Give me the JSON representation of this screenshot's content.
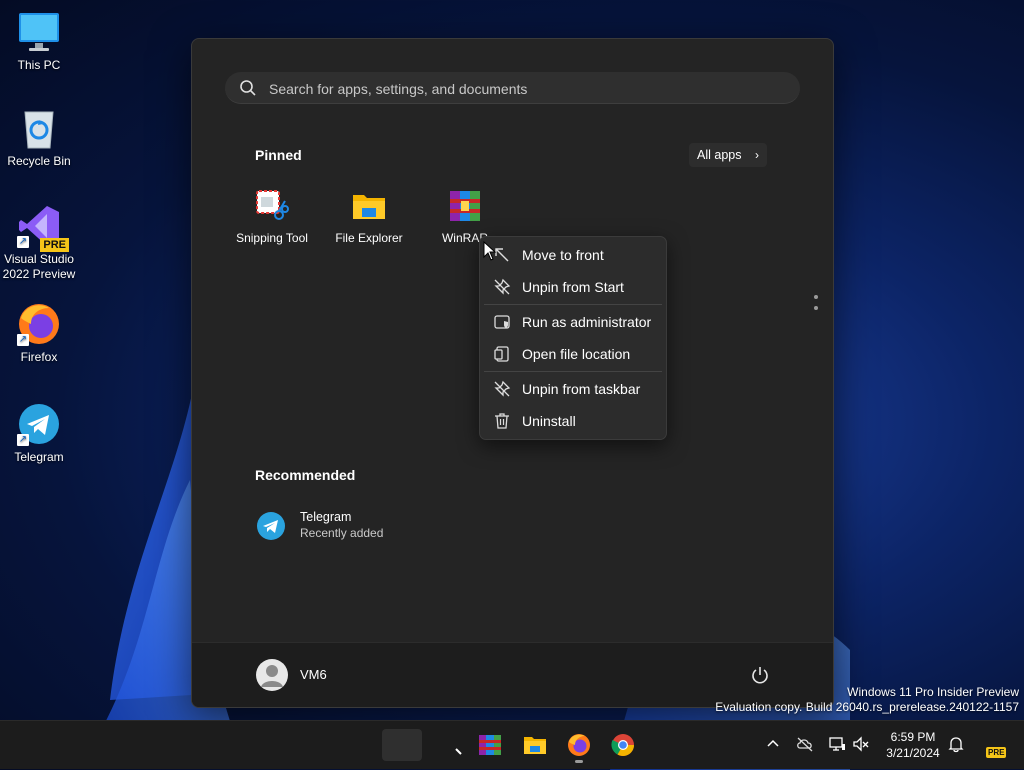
{
  "desktop": {
    "icons": [
      {
        "label": "This PC"
      },
      {
        "label": "Recycle Bin"
      },
      {
        "label": "Visual Studio 2022 Preview",
        "badge": "PRE"
      },
      {
        "label": "Firefox"
      },
      {
        "label": "Telegram"
      }
    ]
  },
  "start_menu": {
    "search_placeholder": "Search for apps, settings, and documents",
    "pinned_title": "Pinned",
    "all_apps_label": "All apps",
    "pinned": [
      {
        "label": "Snipping Tool"
      },
      {
        "label": "File Explorer"
      },
      {
        "label": "WinRAR"
      }
    ],
    "recommended_title": "Recommended",
    "recommended": [
      {
        "name": "Telegram",
        "subtitle": "Recently added"
      }
    ],
    "user_name": "VM6"
  },
  "context_menu": {
    "items": [
      {
        "label": "Move to front",
        "icon": "move-front-icon"
      },
      {
        "label": "Unpin from Start",
        "icon": "unpin-icon"
      },
      {
        "label": "Run as administrator",
        "icon": "shield-icon"
      },
      {
        "label": "Open file location",
        "icon": "folder-location-icon"
      },
      {
        "label": "Unpin from taskbar",
        "icon": "unpin-icon"
      },
      {
        "label": "Uninstall",
        "icon": "trash-icon"
      }
    ]
  },
  "watermark": {
    "line1": "Windows 11 Pro Insider Preview",
    "line2": "Evaluation copy. Build 26040.rs_prerelease.240122-1157"
  },
  "taskbar": {
    "time": "6:59 PM",
    "date": "3/21/2024",
    "pre_badge": "PRE"
  },
  "colors": {
    "accent": "#0078d4",
    "menu_bg": "#242424",
    "taskbar_bg": "#1c1c1c"
  }
}
